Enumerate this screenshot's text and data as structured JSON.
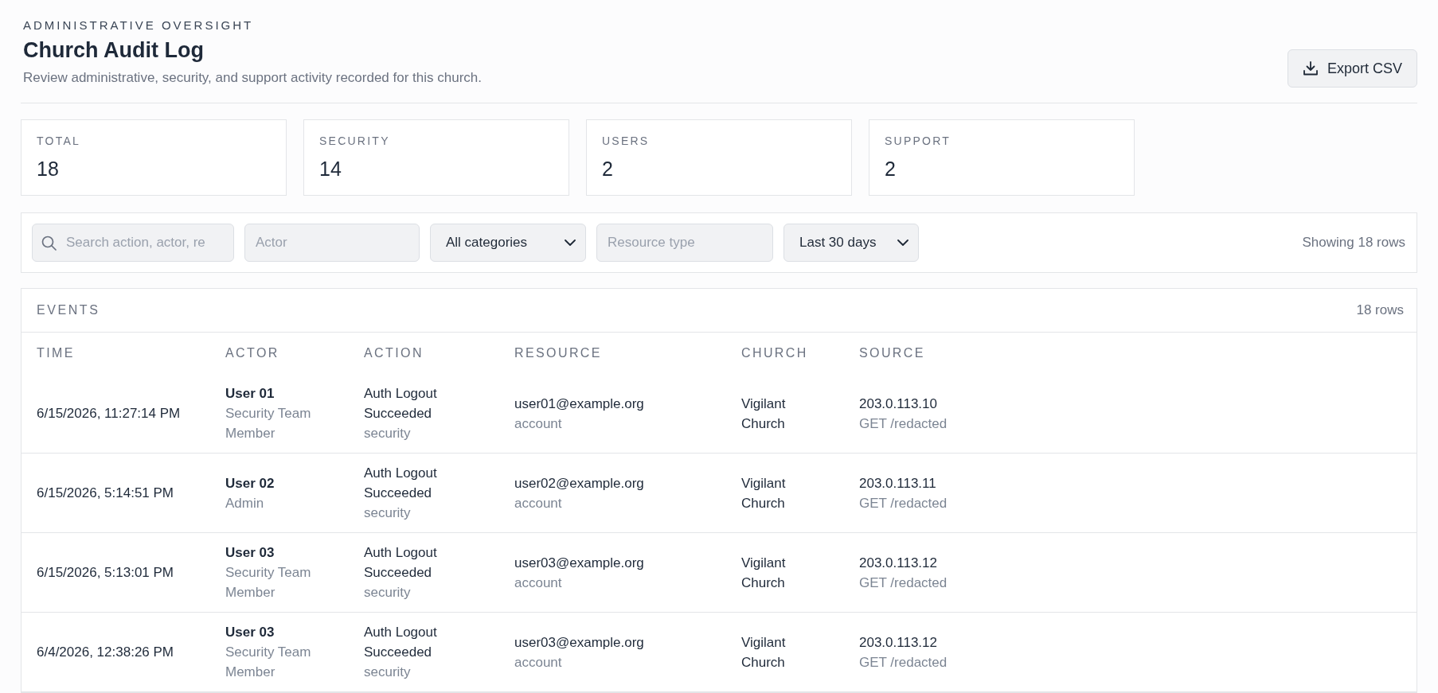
{
  "header": {
    "eyebrow": "ADMINISTRATIVE OVERSIGHT",
    "title": "Church Audit Log",
    "subtitle": "Review administrative, security, and support activity recorded for this church.",
    "export_button": "Export CSV"
  },
  "stats": [
    {
      "label": "TOTAL",
      "value": "18"
    },
    {
      "label": "SECURITY",
      "value": "14"
    },
    {
      "label": "USERS",
      "value": "2"
    },
    {
      "label": "SUPPORT",
      "value": "2"
    }
  ],
  "filters": {
    "fields": [
      {
        "kind": "search",
        "placeholder": "Search action, actor, re"
      },
      {
        "kind": "text",
        "placeholder": "Actor"
      },
      {
        "kind": "select",
        "value": "All categories"
      },
      {
        "kind": "text",
        "placeholder": "Resource type"
      },
      {
        "kind": "select",
        "value": "Last 30 days"
      }
    ],
    "row_count": "Showing 18 rows"
  },
  "events": {
    "title": "EVENTS",
    "count": "18 rows",
    "columns": [
      "TIME",
      "ACTOR",
      "ACTION",
      "RESOURCE",
      "CHURCH",
      "SOURCE"
    ],
    "rows": [
      {
        "time": "6/15/2026, 11:27:14 PM",
        "actor": {
          "name": "User 01",
          "role": "Security Team Member"
        },
        "action": {
          "name": "Auth Logout Succeeded",
          "category": "security"
        },
        "resource": {
          "name": "user01@example.org",
          "type": "account"
        },
        "church": "Vigilant Church",
        "source": {
          "ip": "203.0.113.10",
          "request": "GET /redacted"
        }
      },
      {
        "time": "6/15/2026, 5:14:51 PM",
        "actor": {
          "name": "User 02",
          "role": "Admin"
        },
        "action": {
          "name": "Auth Logout Succeeded",
          "category": "security"
        },
        "resource": {
          "name": "user02@example.org",
          "type": "account"
        },
        "church": "Vigilant Church",
        "source": {
          "ip": "203.0.113.11",
          "request": "GET /redacted"
        }
      },
      {
        "time": "6/15/2026, 5:13:01 PM",
        "actor": {
          "name": "User 03",
          "role": "Security Team Member"
        },
        "action": {
          "name": "Auth Logout Succeeded",
          "category": "security"
        },
        "resource": {
          "name": "user03@example.org",
          "type": "account"
        },
        "church": "Vigilant Church",
        "source": {
          "ip": "203.0.113.12",
          "request": "GET /redacted"
        }
      },
      {
        "time": "6/4/2026, 12:38:26 PM",
        "actor": {
          "name": "User 03",
          "role": "Security Team Member"
        },
        "action": {
          "name": "Auth Logout Succeeded",
          "category": "security"
        },
        "resource": {
          "name": "user03@example.org",
          "type": "account"
        },
        "church": "Vigilant Church",
        "source": {
          "ip": "203.0.113.12",
          "request": "GET /redacted"
        }
      }
    ]
  }
}
